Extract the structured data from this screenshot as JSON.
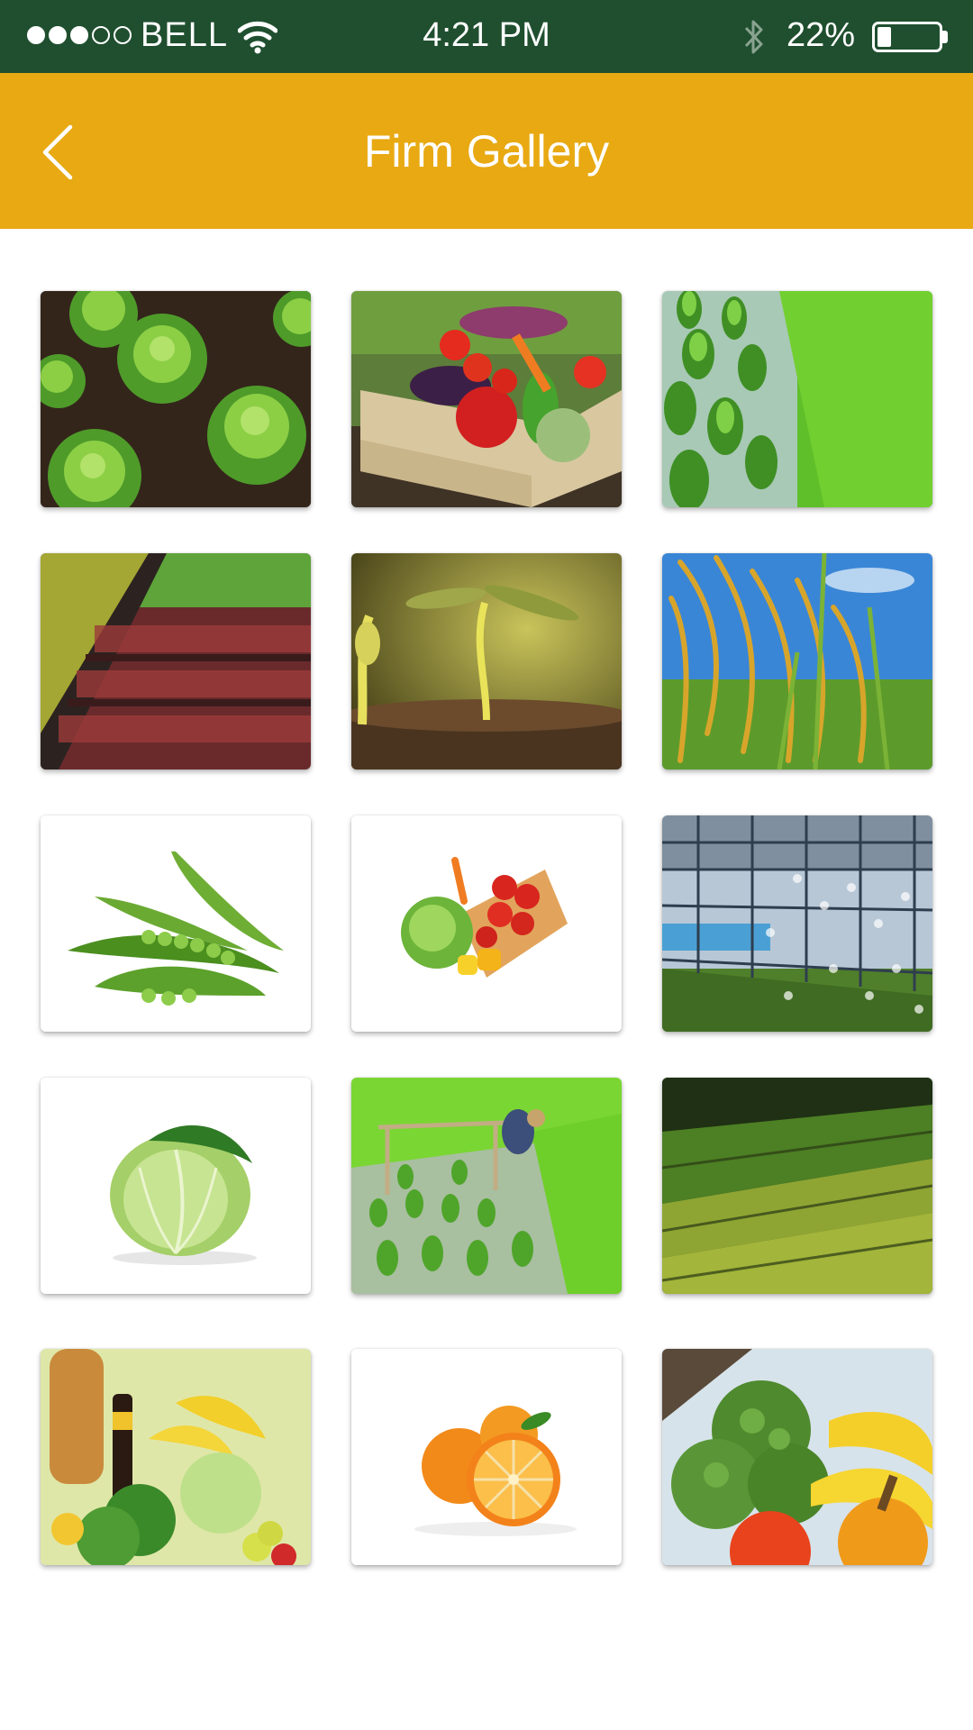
{
  "status_bar": {
    "carrier": "BELL",
    "time": "4:21 PM",
    "battery": "22%",
    "battery_level": 0.22,
    "signal_bars": 3,
    "signal_total": 5,
    "icons": [
      "signal-dots-icon",
      "wifi-icon",
      "bluetooth-icon",
      "battery-icon"
    ]
  },
  "header": {
    "title": "Firm Gallery",
    "back_icon": "chevron-left-icon",
    "background": "#e8a912"
  },
  "colors": {
    "status_bar": "#1f4f2f",
    "header": "#e8a912",
    "title_text": "#ffffff"
  },
  "gallery": {
    "items": [
      {
        "name": "lettuce-field-photo"
      },
      {
        "name": "vegetable-crate-photo"
      },
      {
        "name": "rice-paddy-photo"
      },
      {
        "name": "coleus-nursery-photo"
      },
      {
        "name": "seedling-sprout-photo"
      },
      {
        "name": "rice-ears-photo"
      },
      {
        "name": "green-peas-photo"
      },
      {
        "name": "vegetable-basket-photo"
      },
      {
        "name": "greenhouse-photo"
      },
      {
        "name": "cabbage-photo"
      },
      {
        "name": "farmer-planting-rice-photo"
      },
      {
        "name": "plant-nursery-field-photo"
      },
      {
        "name": "groceries-assortment-photo"
      },
      {
        "name": "oranges-photo"
      },
      {
        "name": "broccoli-fruits-photo"
      }
    ]
  }
}
